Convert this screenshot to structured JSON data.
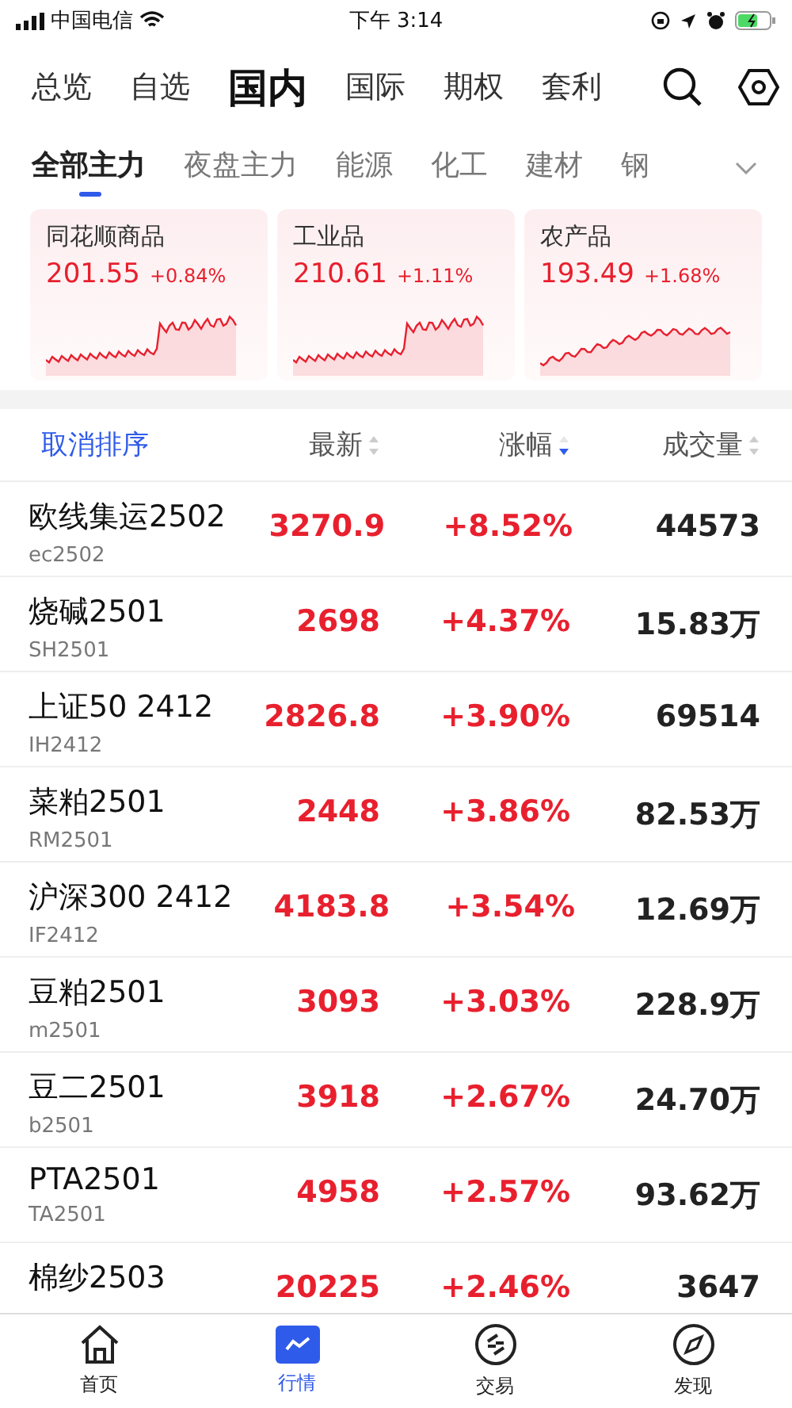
{
  "status_bar": {
    "carrier": "中国电信",
    "time": "下午 3:14"
  },
  "top_tabs": [
    {
      "label": "总览",
      "selected": false
    },
    {
      "label": "自选",
      "selected": false
    },
    {
      "label": "国内",
      "selected": true
    },
    {
      "label": "国际",
      "selected": false
    },
    {
      "label": "期权",
      "selected": false
    },
    {
      "label": "套利",
      "selected": false
    }
  ],
  "sub_tabs": [
    {
      "label": "全部主力",
      "selected": true
    },
    {
      "label": "夜盘主力",
      "selected": false
    },
    {
      "label": "能源",
      "selected": false
    },
    {
      "label": "化工",
      "selected": false
    },
    {
      "label": "建材",
      "selected": false
    },
    {
      "label": "钢",
      "selected": false
    }
  ],
  "index_cards": [
    {
      "name": "同花顺商品",
      "price": "201.55",
      "change": "+0.84%"
    },
    {
      "name": "工业品",
      "price": "210.61",
      "change": "+1.11%"
    },
    {
      "name": "农产品",
      "price": "193.49",
      "change": "+1.68%"
    }
  ],
  "table": {
    "sort_link": "取消排序",
    "columns": [
      {
        "label": "最新",
        "selected": false
      },
      {
        "label": "涨幅",
        "selected": true
      },
      {
        "label": "成交量",
        "selected": false
      }
    ],
    "rows": [
      {
        "name": "欧线集运2502",
        "code": "ec2502",
        "price": "3270.9",
        "change": "+8.52%",
        "volume": "44573"
      },
      {
        "name": "烧碱2501",
        "code": "SH2501",
        "price": "2698",
        "change": "+4.37%",
        "volume": "15.83万"
      },
      {
        "name": "上证50 2412",
        "code": "IH2412",
        "price": "2826.8",
        "change": "+3.90%",
        "volume": "69514"
      },
      {
        "name": "菜粕2501",
        "code": "RM2501",
        "price": "2448",
        "change": "+3.86%",
        "volume": "82.53万"
      },
      {
        "name": "沪深300 2412",
        "code": "IF2412",
        "price": "4183.8",
        "change": "+3.54%",
        "volume": "12.69万"
      },
      {
        "name": "豆粕2501",
        "code": "m2501",
        "price": "3093",
        "change": "+3.03%",
        "volume": "228.9万"
      },
      {
        "name": "豆二2501",
        "code": "b2501",
        "price": "3918",
        "change": "+2.67%",
        "volume": "24.70万"
      },
      {
        "name": "PTA2501",
        "code": "TA2501",
        "price": "4958",
        "change": "+2.57%",
        "volume": "93.62万"
      },
      {
        "name": "棉纱2503",
        "price": "20225",
        "change": "+2.46%",
        "volume": "3647"
      }
    ]
  },
  "bottom_nav": [
    {
      "label": "首页",
      "selected": false
    },
    {
      "label": "行情",
      "selected": true
    },
    {
      "label": "交易",
      "selected": false
    },
    {
      "label": "发现",
      "selected": false
    }
  ]
}
